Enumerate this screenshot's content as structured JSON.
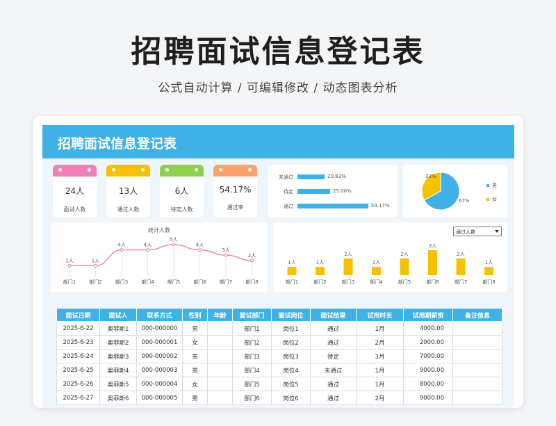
{
  "hero": {
    "title": "招聘面试信息登记表",
    "subtitle": "公式自动计算 /  可编辑修改  / 动态图表分析"
  },
  "sheet": {
    "title": "招聘面试信息登记表"
  },
  "kpis": [
    {
      "value": "24人",
      "label": "面试人数",
      "color": "#f180b8"
    },
    {
      "value": "13人",
      "label": "通过人数",
      "color": "#f6c200"
    },
    {
      "value": "6人",
      "label": "待定人数",
      "color": "#8fd04f"
    },
    {
      "value": "54.17%",
      "label": "通过率",
      "color": "#f9a36b"
    }
  ],
  "status_chart": {
    "rows": [
      {
        "label": "未通过",
        "value": 20.83,
        "text": "20.83%"
      },
      {
        "label": "待定",
        "value": 25.0,
        "text": "25.00%"
      },
      {
        "label": "通过",
        "value": 54.17,
        "text": "54.17%"
      }
    ]
  },
  "gender_chart": {
    "slices": [
      {
        "name": "男",
        "value": 67,
        "text": "67%",
        "color": "#3fb1e6"
      },
      {
        "name": "女",
        "value": 33,
        "text": "33%",
        "color": "#f6c200"
      }
    ]
  },
  "chart_data": [
    {
      "type": "line",
      "title": "统计人数",
      "categories": [
        "部门1",
        "部门2",
        "部门3",
        "部门4",
        "部门5",
        "部门6",
        "部门7",
        "部门8"
      ],
      "values": [
        1,
        1,
        4,
        4,
        5,
        4,
        3,
        2
      ],
      "labels": [
        "1人",
        "1人",
        "4人",
        "4人",
        "5人",
        "4人",
        "3人",
        "2人"
      ],
      "color": "#e67ea1"
    },
    {
      "type": "bar",
      "categories": [
        "部门1",
        "部门2",
        "部门3",
        "部门4",
        "部门5",
        "部门6",
        "部门7",
        "部门8"
      ],
      "values": [
        1,
        1,
        2,
        1,
        2,
        3,
        2,
        1
      ],
      "labels": [
        "1人",
        "1人",
        "2人",
        "1人",
        "2人",
        "3人",
        "2人",
        "1人"
      ],
      "color": "#f6c200"
    }
  ],
  "dropdown": {
    "value": "通过人数"
  },
  "table": {
    "headers": [
      "面试日期",
      "面试人",
      "联系方式",
      "性别",
      "年龄",
      "面试部门",
      "面试岗位",
      "面试结果",
      "试用时长",
      "试用期薪资",
      "备注信息"
    ],
    "rows": [
      [
        "2025-6-22",
        "奥菲斯1",
        "000-000000",
        "男",
        "",
        "部门1",
        "岗位1",
        "通过",
        "1月",
        "4000.00",
        ""
      ],
      [
        "2025-6-23",
        "奥菲斯2",
        "000-000001",
        "女",
        "",
        "部门2",
        "岗位2",
        "通过",
        "2月",
        "2000.00",
        ""
      ],
      [
        "2025-6-24",
        "奥菲斯3",
        "000-000002",
        "男",
        "",
        "部门3",
        "岗位3",
        "待定",
        "3月",
        "7000.00",
        ""
      ],
      [
        "2025-6-25",
        "奥菲斯4",
        "000-000003",
        "男",
        "",
        "部门4",
        "岗位4",
        "未通过",
        "1月",
        "9000.00",
        ""
      ],
      [
        "2025-6-26",
        "奥菲斯5",
        "000-000004",
        "女",
        "",
        "部门5",
        "岗位5",
        "通过",
        "1月",
        "8000.00",
        ""
      ],
      [
        "2025-6-27",
        "奥菲斯6",
        "000-000005",
        "男",
        "",
        "部门6",
        "岗位6",
        "通过",
        "2月",
        "9000.00",
        ""
      ]
    ]
  }
}
